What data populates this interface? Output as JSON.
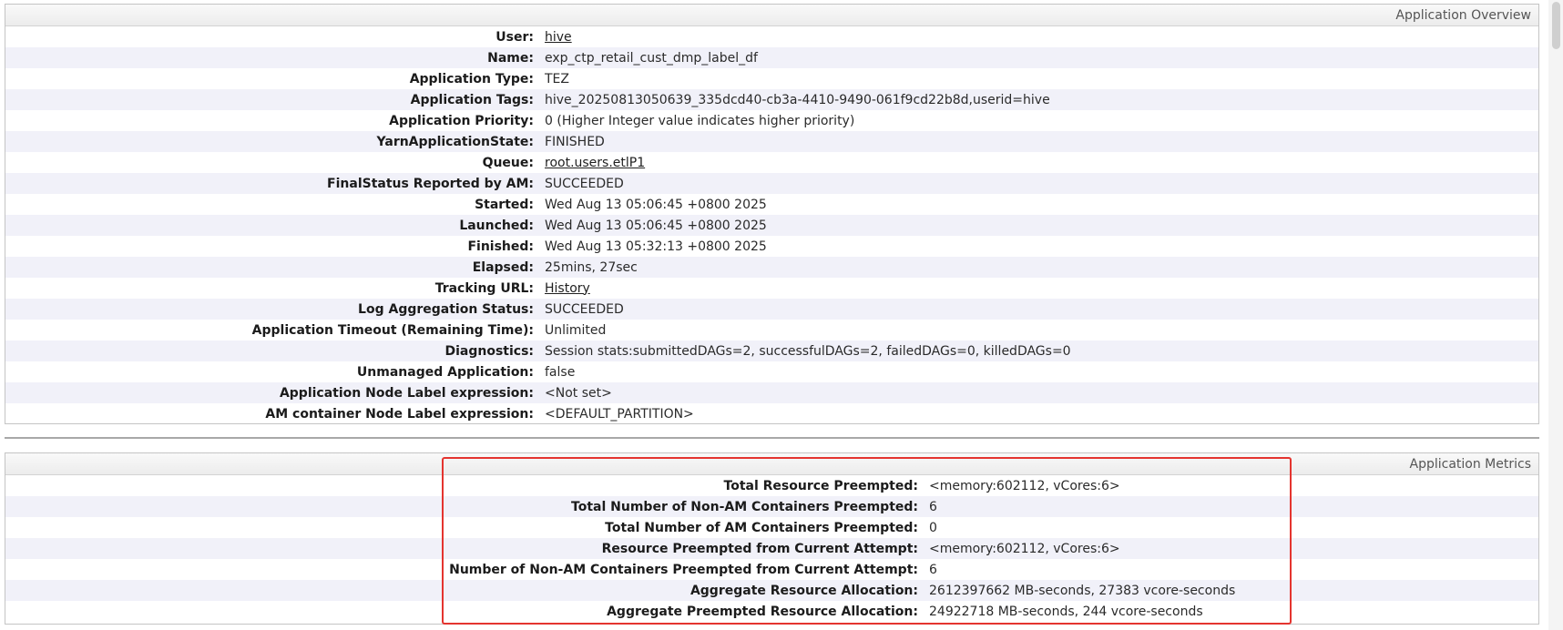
{
  "overview": {
    "title": "Application Overview",
    "rows": [
      {
        "label": "User:",
        "value": "hive",
        "link": true
      },
      {
        "label": "Name:",
        "value": "exp_ctp_retail_cust_dmp_label_df",
        "link": false
      },
      {
        "label": "Application Type:",
        "value": "TEZ",
        "link": false
      },
      {
        "label": "Application Tags:",
        "value": "hive_20250813050639_335dcd40-cb3a-4410-9490-061f9cd22b8d,userid=hive",
        "link": false
      },
      {
        "label": "Application Priority:",
        "value": "0 (Higher Integer value indicates higher priority)",
        "link": false
      },
      {
        "label": "YarnApplicationState:",
        "value": "FINISHED",
        "link": false
      },
      {
        "label": "Queue:",
        "value": "root.users.etlP1",
        "link": true
      },
      {
        "label": "FinalStatus Reported by AM:",
        "value": "SUCCEEDED",
        "link": false
      },
      {
        "label": "Started:",
        "value": "Wed Aug 13 05:06:45 +0800 2025",
        "link": false
      },
      {
        "label": "Launched:",
        "value": "Wed Aug 13 05:06:45 +0800 2025",
        "link": false
      },
      {
        "label": "Finished:",
        "value": "Wed Aug 13 05:32:13 +0800 2025",
        "link": false
      },
      {
        "label": "Elapsed:",
        "value": "25mins, 27sec",
        "link": false
      },
      {
        "label": "Tracking URL:",
        "value": "History",
        "link": true
      },
      {
        "label": "Log Aggregation Status:",
        "value": "SUCCEEDED",
        "link": false
      },
      {
        "label": "Application Timeout (Remaining Time):",
        "value": "Unlimited",
        "link": false
      },
      {
        "label": "Diagnostics:",
        "value": "Session stats:submittedDAGs=2, successfulDAGs=2, failedDAGs=0, killedDAGs=0",
        "link": false
      },
      {
        "label": "Unmanaged Application:",
        "value": "false",
        "link": false
      },
      {
        "label": "Application Node Label expression:",
        "value": "<Not set>",
        "link": false
      },
      {
        "label": "AM container Node Label expression:",
        "value": "<DEFAULT_PARTITION>",
        "link": false
      }
    ]
  },
  "metrics": {
    "title": "Application Metrics",
    "rows": [
      {
        "label": "Total Resource Preempted:",
        "value": "<memory:602112, vCores:6>"
      },
      {
        "label": "Total Number of Non-AM Containers Preempted:",
        "value": "6"
      },
      {
        "label": "Total Number of AM Containers Preempted:",
        "value": "0"
      },
      {
        "label": "Resource Preempted from Current Attempt:",
        "value": "<memory:602112, vCores:6>"
      },
      {
        "label": "Number of Non-AM Containers Preempted from Current Attempt:",
        "value": "6"
      },
      {
        "label": "Aggregate Resource Allocation:",
        "value": "2612397662 MB-seconds, 27383 vcore-seconds"
      },
      {
        "label": "Aggregate Preempted Resource Allocation:",
        "value": "24922718 MB-seconds, 244 vcore-seconds"
      }
    ]
  },
  "colors": {
    "highlight": "#e4342f",
    "row_alt": "#f1f1f9"
  }
}
